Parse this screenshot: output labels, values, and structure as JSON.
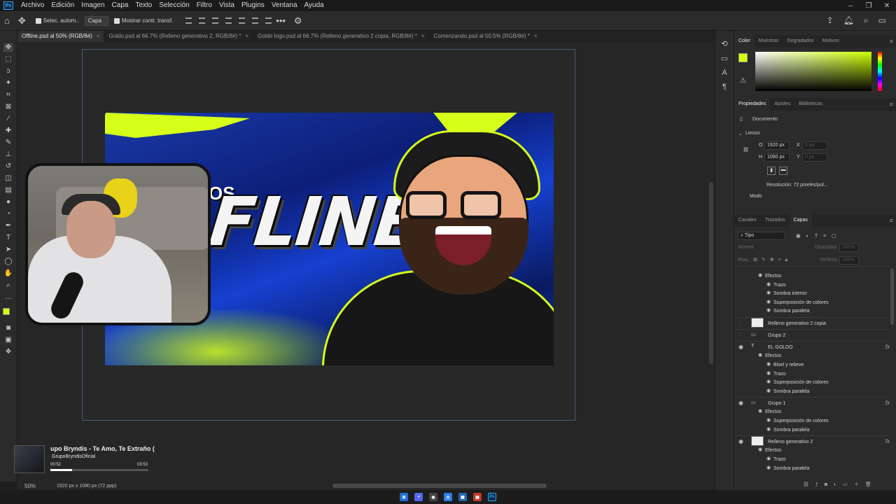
{
  "menu": {
    "items": [
      "Archivo",
      "Edición",
      "Imagen",
      "Capa",
      "Texto",
      "Selección",
      "Filtro",
      "Vista",
      "Plugins",
      "Ventana",
      "Ayuda"
    ],
    "app_logo": "Ps"
  },
  "options": {
    "auto_select_label": "Selec. autom.:",
    "auto_select_value": "Capa",
    "show_transform_label": "Mostrar contr. transf."
  },
  "tabs": [
    {
      "label": "Offline.psd al 50% (RGB/8#)",
      "active": true
    },
    {
      "label": "Goldo.psd al 66.7% (Relleno generativo 2, RGB/8#) *",
      "active": false
    },
    {
      "label": "Goldo logo.psd al 66.7% (Relleno generativo 2 copia, RGB/8#) *",
      "active": false
    },
    {
      "label": "Comenzando.psd al 50.5% (RGB/8#) *",
      "active": false
    }
  ],
  "canvas": {
    "title_small": "OS",
    "title_big": "FLINE"
  },
  "music": {
    "song": "upo Bryndis - Te Amo, Te Extraño (",
    "artist": "GrupoBryndisOficial",
    "time_elapsed": "00:52",
    "time_total": "03:53",
    "progress": 0.22
  },
  "status": {
    "zoom": "50%",
    "doc_info": "1920 px x 1080 px (72 ppp)"
  },
  "color_panel": {
    "tabs": [
      "Color",
      "Muestras",
      "Degradados",
      "Motivos"
    ],
    "foreground": "#d9ff00",
    "background": "#ffffff"
  },
  "properties": {
    "tabs": [
      "Propiedades",
      "Ajustes",
      "Bibliotecas"
    ],
    "section": "Documento",
    "canvas_header": "Lienzo",
    "width_label": "O",
    "width_value": "1920 px",
    "height_label": "H",
    "height_value": "1080 px",
    "x_label": "X",
    "x_value": "0 px",
    "y_label": "Y",
    "y_value": "0 px",
    "resolution": "Resolución: 72 píxeles/pul...",
    "mode_label": "Modo"
  },
  "layers": {
    "tabs": [
      "Canales",
      "Trazados",
      "Capas"
    ],
    "filter_kind": "Tipo",
    "blend_mode": "Normal",
    "opacity_label": "Opacidad:",
    "opacity_value": "100%",
    "lock_label": "Bloq.:",
    "fill_label": "Relleno:",
    "fill_value": "100%",
    "rows": [
      {
        "name": "Efectos",
        "indent": 1
      },
      {
        "name": "Trazo",
        "indent": 2
      },
      {
        "name": "Sombra interior",
        "indent": 2
      },
      {
        "name": "Superposición de colores",
        "indent": 2
      },
      {
        "name": "Sombra paralela",
        "indent": 2
      },
      {
        "name": "Relleno generativo 2 copia",
        "indent": 0,
        "thumb": true
      },
      {
        "name": "Grupo 2",
        "indent": 0,
        "folder": true
      },
      {
        "name": "EL GOLDO",
        "indent": 0,
        "text": true,
        "fx": true,
        "visible": true
      },
      {
        "name": "Efectos",
        "indent": 1
      },
      {
        "name": "Bisel y relieve",
        "indent": 2
      },
      {
        "name": "Trazo",
        "indent": 2
      },
      {
        "name": "Superposición de colores",
        "indent": 2
      },
      {
        "name": "Sombra paralela",
        "indent": 2
      },
      {
        "name": "Grupo 1",
        "indent": 0,
        "folder": true,
        "fx": true,
        "visible": true
      },
      {
        "name": "Efectos",
        "indent": 1
      },
      {
        "name": "Superposición de colores",
        "indent": 2
      },
      {
        "name": "Sombra paralela",
        "indent": 2
      },
      {
        "name": "Relleno generativo 2",
        "indent": 0,
        "thumb": true,
        "fx": true,
        "visible": true
      },
      {
        "name": "Efectos",
        "indent": 1
      },
      {
        "name": "Trazo",
        "indent": 2
      },
      {
        "name": "Sombra paralela",
        "indent": 2
      }
    ],
    "fx_label": "fx"
  }
}
